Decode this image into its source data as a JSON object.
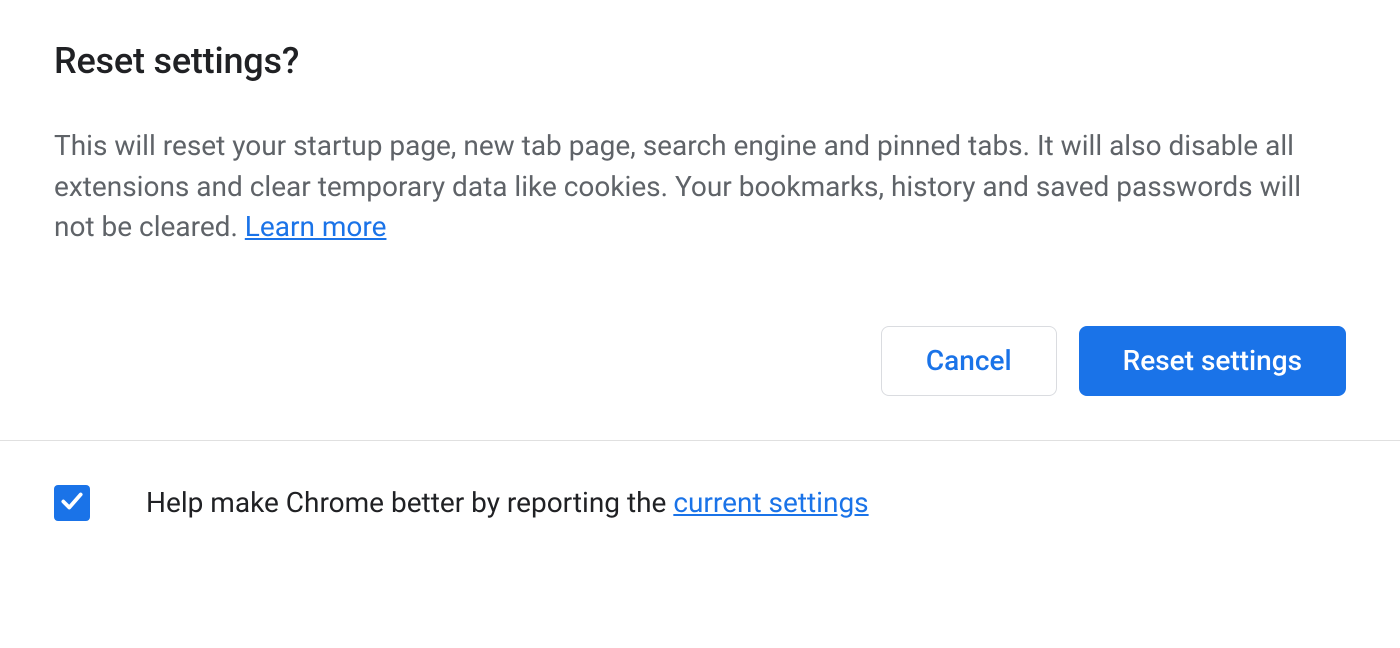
{
  "dialog": {
    "title": "Reset settings?",
    "description": "This will reset your startup page, new tab page, search engine and pinned tabs. It will also disable all extensions and clear temporary data like cookies. Your bookmarks, history and saved passwords will not be cleared. ",
    "learn_more": "Learn more"
  },
  "buttons": {
    "cancel": "Cancel",
    "confirm": "Reset settings"
  },
  "footer": {
    "checkbox_checked": true,
    "text_before": "Help make Chrome better by reporting the ",
    "link": "current settings"
  },
  "colors": {
    "primary": "#1a73e8",
    "text_primary": "#202124",
    "text_secondary": "#5f6368",
    "border": "#dadce0"
  }
}
